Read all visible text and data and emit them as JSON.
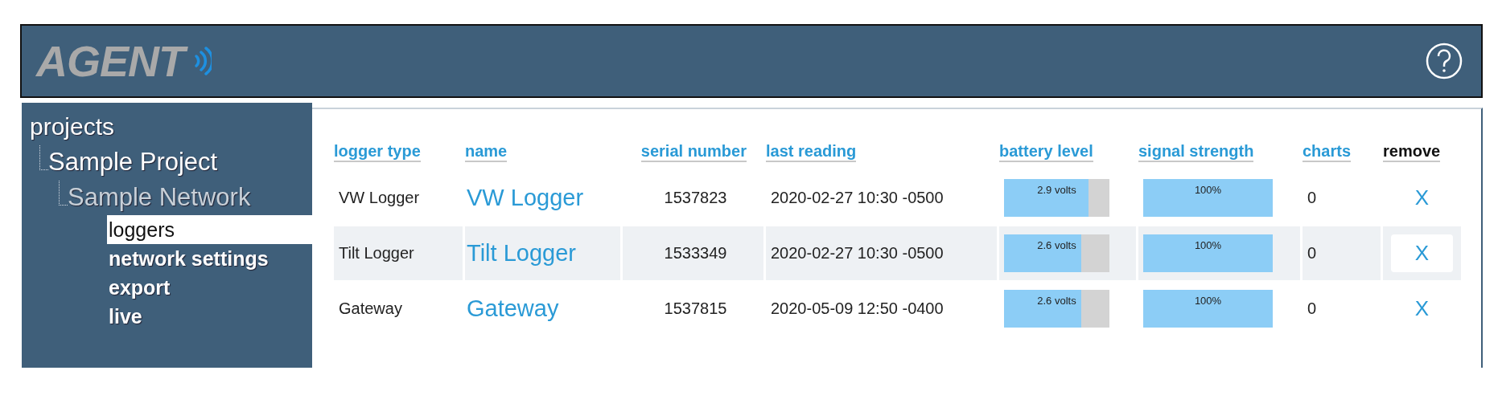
{
  "header": {
    "logo": "AGENT"
  },
  "sidebar": {
    "tree": [
      {
        "label": "projects",
        "children": [
          {
            "label": "Sample Project",
            "children": [
              {
                "label": "Sample Network",
                "children": [
                  {
                    "label": "loggers",
                    "selected": true
                  },
                  {
                    "label": "network settings",
                    "selected": false
                  },
                  {
                    "label": "export",
                    "selected": false
                  },
                  {
                    "label": "live",
                    "selected": false
                  }
                ]
              }
            ]
          }
        ]
      }
    ]
  },
  "table": {
    "columns": [
      "logger type",
      "name",
      "serial number",
      "last reading",
      "battery level",
      "signal strength",
      "charts",
      "remove"
    ],
    "rows": [
      {
        "logger_type": "VW Logger",
        "name": "VW Logger",
        "serial_number": "1537823",
        "last_reading": "2020-02-27 10:30 -0500",
        "battery": {
          "reading": "2.9 volts",
          "level": 0.8
        },
        "signal": {
          "reading": "100%",
          "level": 1
        },
        "charts": "0",
        "remove": "X",
        "highlighted": false
      },
      {
        "logger_type": "Tilt Logger",
        "name": "Tilt Logger",
        "serial_number": "1533349",
        "last_reading": "2020-02-27 10:30 -0500",
        "battery": {
          "reading": "2.6 volts",
          "level": 0.73
        },
        "signal": {
          "reading": "100%",
          "level": 1
        },
        "charts": "0",
        "remove": "X",
        "highlighted": true
      },
      {
        "logger_type": "Gateway",
        "name": "Gateway",
        "serial_number": "1537815",
        "last_reading": "2020-05-09 12:50 -0400",
        "battery": {
          "reading": "2.6 volts",
          "level": 0.73
        },
        "signal": {
          "reading": "100%",
          "level": 1
        },
        "charts": "0",
        "remove": "X",
        "highlighted": false
      }
    ]
  }
}
